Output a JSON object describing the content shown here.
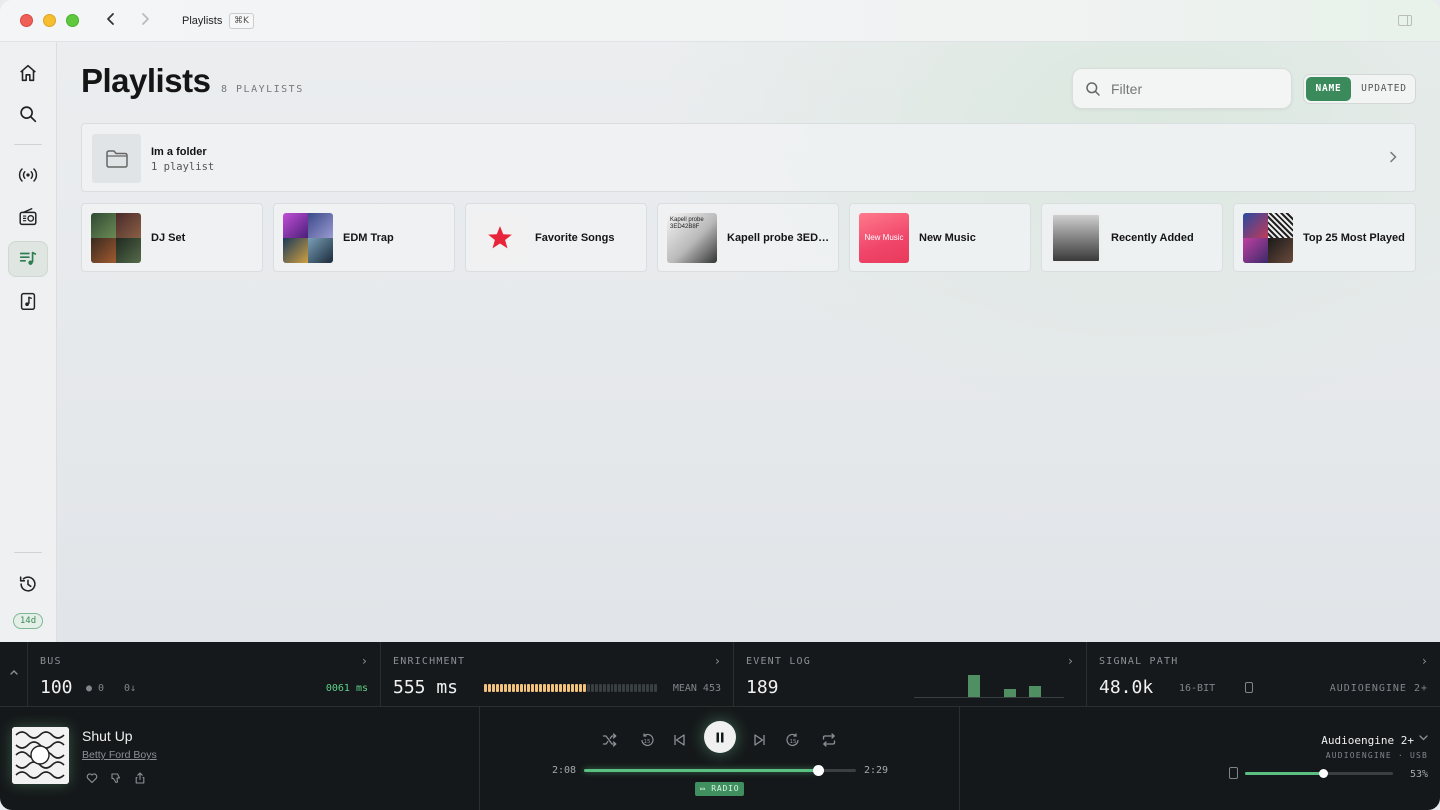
{
  "titlebar": {
    "title": "Playlists",
    "shortcut": "⌘K"
  },
  "sidebar": {
    "items": [
      {
        "icon": "home-icon",
        "active": false
      },
      {
        "icon": "search-icon",
        "active": false
      },
      {
        "icon": "radio-broadcast-icon",
        "active": false
      },
      {
        "icon": "radio-icon",
        "active": false
      },
      {
        "icon": "playlist-icon",
        "active": true
      },
      {
        "icon": "music-note-icon",
        "active": false
      },
      {
        "icon": "history-icon",
        "active": false
      }
    ],
    "badge": "14d"
  },
  "header": {
    "title": "Playlists",
    "count": "8 PLAYLISTS",
    "filter_placeholder": "Filter",
    "sort": {
      "name": "NAME",
      "updated": "UPDATED",
      "selected": "NAME"
    }
  },
  "folder": {
    "name": "Im a folder",
    "sub": "1 playlist"
  },
  "playlists": [
    {
      "name": "DJ Set"
    },
    {
      "name": "EDM Trap"
    },
    {
      "name": "Favorite Songs"
    },
    {
      "name": "Kapell probe 3ED4...",
      "art_text": "Kapell probe 3ED42B8F"
    },
    {
      "name": "New Music",
      "art_text": "New Music"
    },
    {
      "name": "Recently Added"
    },
    {
      "name": "Top 25 Most Played"
    }
  ],
  "stats": {
    "bus": {
      "label": "BUS",
      "value": "100",
      "in": "0",
      "out": "0↓",
      "latency": "0061 ms"
    },
    "enrichment": {
      "label": "ENRICHMENT",
      "value": "555 ms",
      "mean": "MEAN 453",
      "fill_fraction": 0.58
    },
    "event_log": {
      "label": "EVENT LOG",
      "value": "189",
      "bars": [
        0.8,
        0,
        0,
        0,
        0.3,
        0.4
      ]
    },
    "signal_path": {
      "label": "SIGNAL PATH",
      "rate": "48.0k",
      "depth": "16-BIT",
      "device": "AUDIOENGINE 2+"
    }
  },
  "player": {
    "title": "Shut Up",
    "artist": "Betty Ford Boys",
    "elapsed": "2:08",
    "duration": "2:29",
    "progress": 0.86,
    "mode_badge": "RADIO",
    "device": "Audioengine 2+",
    "device_sub": "AUDIOENGINE · USB",
    "volume": "53%",
    "volume_fraction": 0.53
  },
  "colors": {
    "accent": "#3a8a5b",
    "accent_bright": "#5bbf82",
    "panel_dark": "#15181a"
  }
}
